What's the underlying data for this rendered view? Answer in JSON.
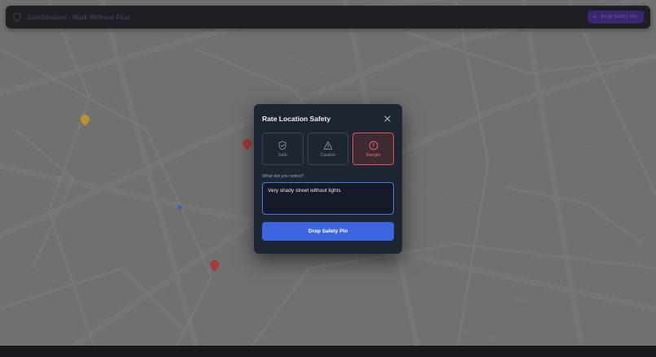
{
  "header": {
    "title": "SafeShadow - Walk Without Fear",
    "action_label": "Drop Safety Pin"
  },
  "modal": {
    "title": "Rate Location Safety",
    "options": [
      {
        "label": "Safe",
        "icon": "shield-check-icon",
        "selected": false
      },
      {
        "label": "Caution",
        "icon": "warning-triangle-icon",
        "selected": false
      },
      {
        "label": "Danger",
        "icon": "alert-circle-icon",
        "selected": true
      }
    ],
    "notes_label": "What did you notice?",
    "notes_value": "Very shady street without lights",
    "submit_label": "Drop Safety Pin"
  },
  "colors": {
    "danger": "#e05252",
    "primary": "#3b66e0",
    "caution_pin": "#c9a227",
    "danger_pin": "#c73a3a",
    "user_dot": "#3b66e0"
  }
}
